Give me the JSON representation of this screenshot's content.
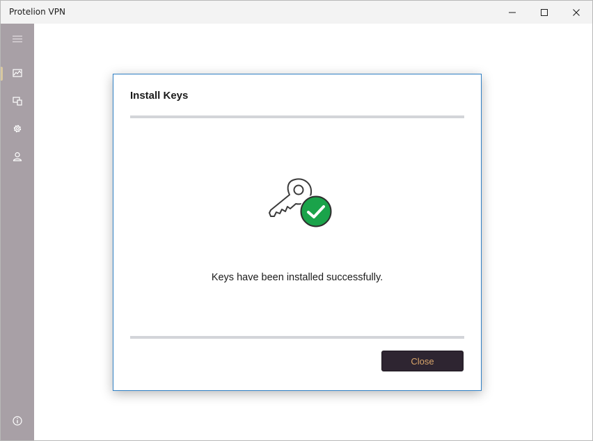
{
  "window": {
    "title": "Protelion VPN"
  },
  "titlebar_icons": [
    "minimize-icon",
    "maximize-icon",
    "close-icon"
  ],
  "sidebar": {
    "items": [
      {
        "icon": "menu-icon"
      },
      {
        "icon": "network-map-icon",
        "active": true
      },
      {
        "icon": "devices-icon"
      },
      {
        "icon": "settings-gear-icon"
      },
      {
        "icon": "user-icon"
      },
      {
        "icon": "info-icon"
      }
    ]
  },
  "dialog": {
    "title": "Install Keys",
    "message": "Keys have been installed successfully.",
    "graphic_icon": "key-success-icon",
    "close_label": "Close"
  },
  "colors": {
    "sidebar_bg": "#a8a0a6",
    "button_bg": "#2e2531",
    "button_text": "#d9a56a",
    "success_green": "#1aa34a",
    "dialog_border": "#2f7fc4",
    "divider": "#d3d5d9"
  }
}
